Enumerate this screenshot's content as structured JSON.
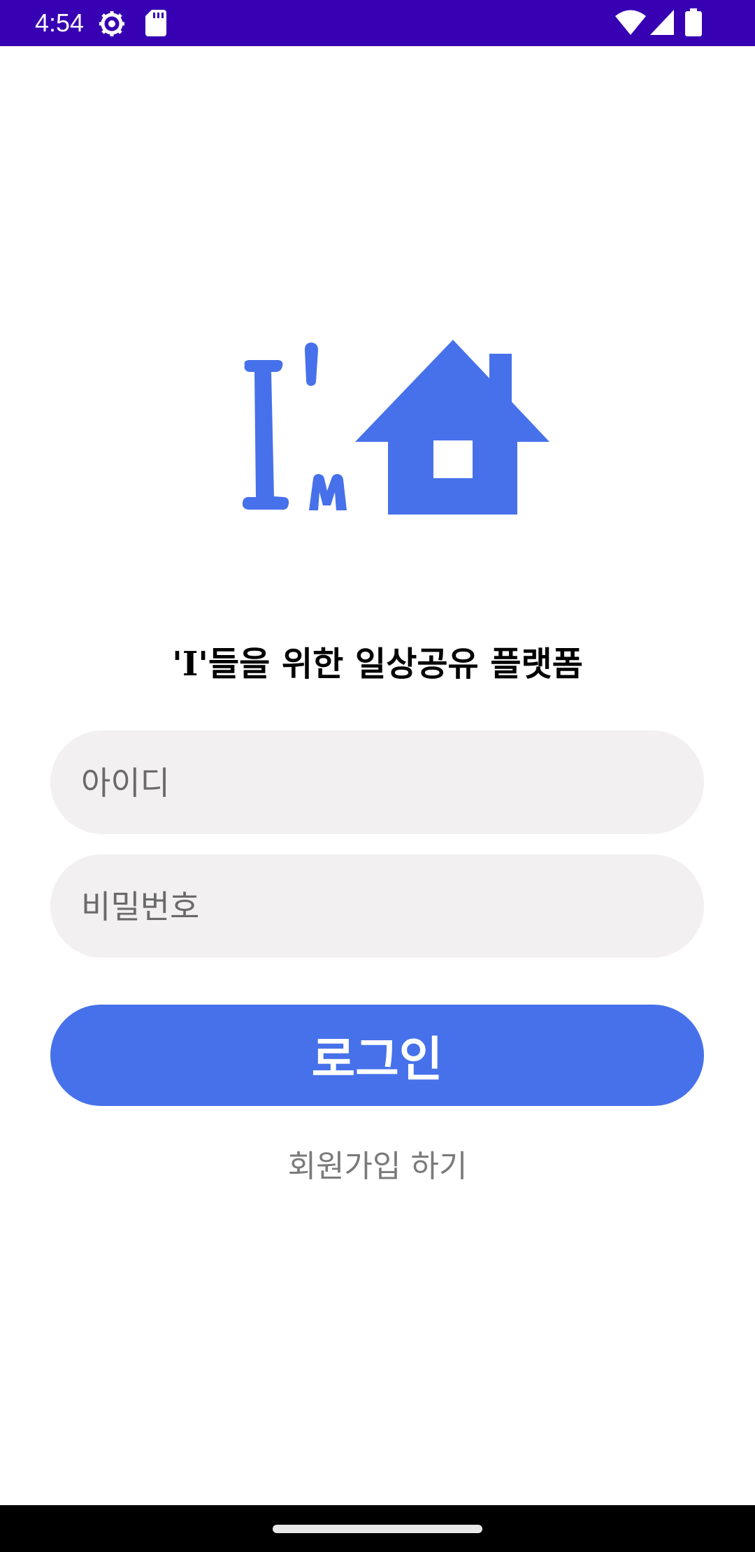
{
  "status_bar": {
    "time": "4:54",
    "icons": [
      "settings-gear-icon",
      "sd-card-icon",
      "wifi-icon",
      "cell-signal-icon",
      "battery-icon"
    ],
    "background": "#3700b3"
  },
  "logo": {
    "text": "I'm",
    "icon": "house-icon",
    "color": "#4771ea"
  },
  "tagline": "'I'들을 위한 일상공유 플랫폼",
  "login_form": {
    "id_placeholder": "아이디",
    "password_placeholder": "비밀번호",
    "login_label": "로그인",
    "signup_label": "회원가입 하기"
  },
  "colors": {
    "accent": "#4771ea",
    "field_background": "#f2f0f1",
    "hint_text": "#6a6a6a"
  }
}
